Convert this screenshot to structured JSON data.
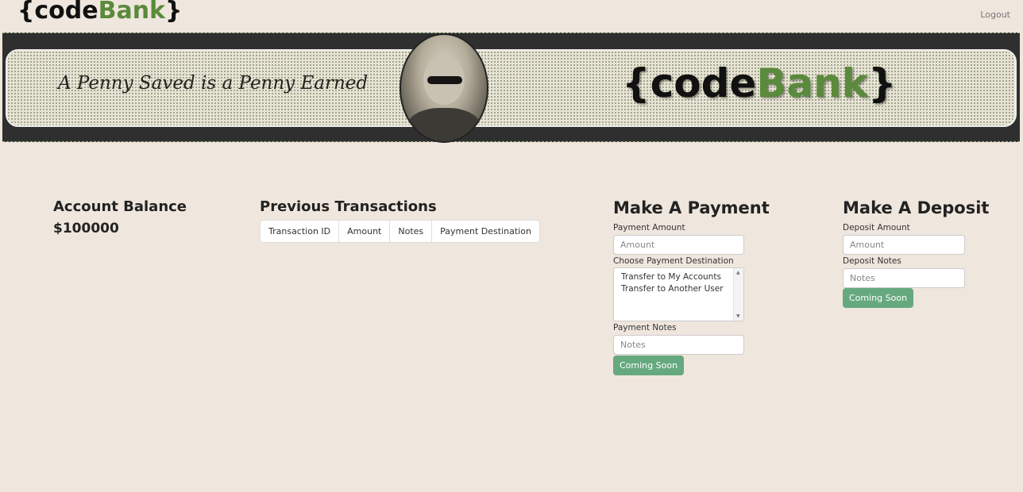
{
  "header": {
    "logo": {
      "open_brace": "{",
      "code": "code",
      "bank": "Bank",
      "close_brace": "}"
    },
    "logout_label": "Logout"
  },
  "banner": {
    "slogan": "A Penny Saved is a Penny Earned",
    "logo": {
      "open_brace": "{",
      "code": "code",
      "bank": "Bank",
      "close_brace": "}"
    }
  },
  "account": {
    "title": "Account Balance",
    "balance": "$100000"
  },
  "transactions": {
    "title": "Previous Transactions",
    "columns": [
      "Transaction ID",
      "Amount",
      "Notes",
      "Payment Destination"
    ]
  },
  "payment": {
    "title": "Make A Payment",
    "amount_label": "Payment Amount",
    "amount_placeholder": "Amount",
    "destination_label": "Choose Payment Destination",
    "destination_options": [
      "Transfer to My Accounts",
      "Transfer to Another User"
    ],
    "notes_label": "Payment Notes",
    "notes_placeholder": "Notes",
    "button_label": "Coming Soon"
  },
  "deposit": {
    "title": "Make A Deposit",
    "amount_label": "Deposit Amount",
    "amount_placeholder": "Amount",
    "notes_label": "Deposit Notes",
    "notes_placeholder": "Notes",
    "button_label": "Coming Soon"
  },
  "colors": {
    "background": "#efe6dd",
    "brand_green": "#5a8a3c",
    "button_green": "#66a97f"
  }
}
